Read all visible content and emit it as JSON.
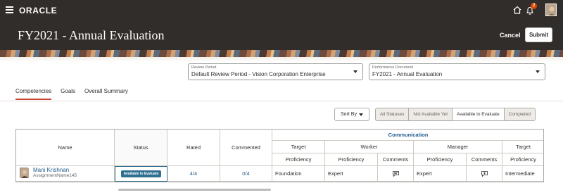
{
  "topbar": {
    "brand": "ORACLE",
    "notification_count": "2",
    "icons": [
      "hamburger-menu-icon",
      "home-icon",
      "bell-icon",
      "user-avatar"
    ]
  },
  "header": {
    "title": "FY2021 - Annual Evaluation",
    "cancel_label": "Cancel",
    "submit_label": "Submit"
  },
  "selectors": {
    "review_period": {
      "label": "Review Period",
      "value": "Default Review Period - Vision Corporation Enterprise"
    },
    "performance_document": {
      "label": "Performance Document",
      "value": "FY2021 - Annual Evaluation"
    }
  },
  "tabs": [
    {
      "label": "Competencies",
      "active": true
    },
    {
      "label": "Goals",
      "active": false
    },
    {
      "label": "Overall Summary",
      "active": false
    }
  ],
  "toolbar": {
    "sort_label": "Sort By",
    "filters": [
      {
        "label": "All Statuses",
        "selected": false
      },
      {
        "label": "Not Available Yet",
        "selected": false
      },
      {
        "label": "Available to Evaluate",
        "selected": true
      },
      {
        "label": "Completed",
        "selected": false
      }
    ]
  },
  "table": {
    "headers": {
      "name": "Name",
      "status": "Status",
      "rated": "Rated",
      "commented": "Commented",
      "group": "Communication",
      "target": "Target",
      "worker": "Worker",
      "manager": "Manager",
      "target2": "Target",
      "proficiency": "Proficiency",
      "comments": "Comments"
    },
    "rows": [
      {
        "name": "Mani Krishnan",
        "assignment": "AssignmentName145",
        "status": "Available to Evaluate",
        "rated": "4/4",
        "commented": "0/4",
        "target_proficiency": "Foundation",
        "worker_proficiency": "Expert",
        "manager_proficiency": "Expert",
        "target2_proficiency": "Intermediate"
      }
    ]
  },
  "colors": {
    "header_bg": "#312d2a",
    "accent_tab": "#c74634",
    "link": "#1f5a8c",
    "status_pill": "#2f6f92",
    "badge": "#d64700"
  }
}
